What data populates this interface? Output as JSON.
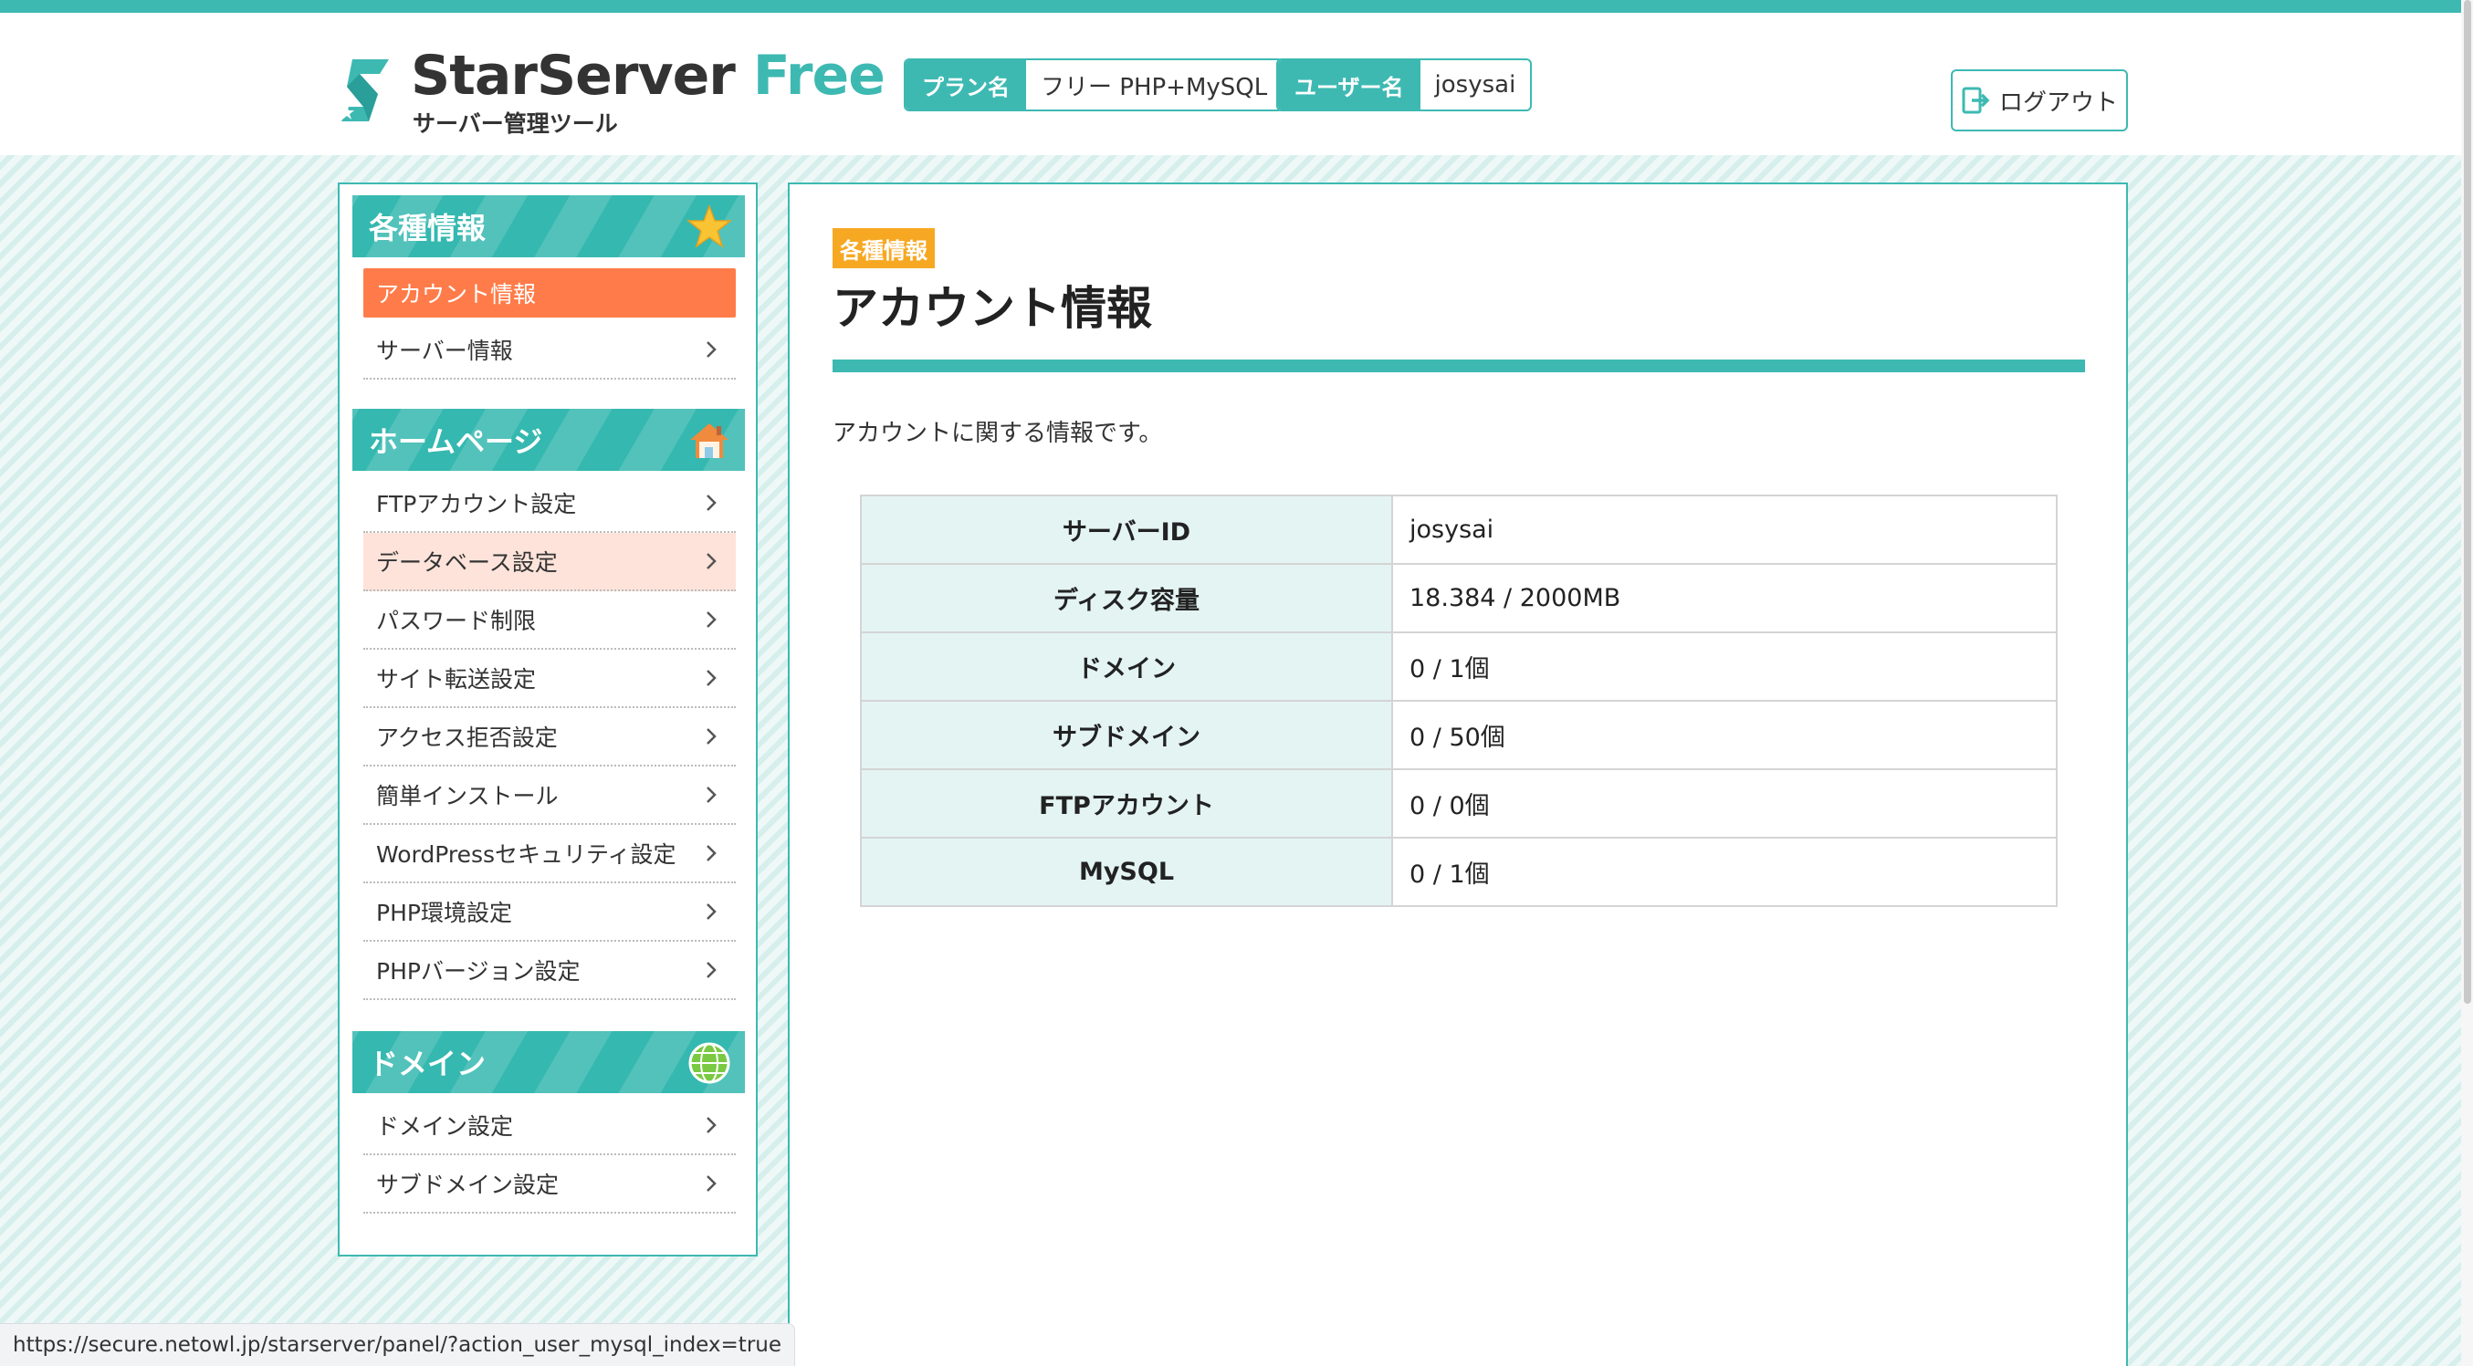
{
  "header": {
    "logo": {
      "name": "StarServer",
      "name_accent": "Free",
      "subtitle": "サーバー管理ツール"
    },
    "plan": {
      "label": "プラン名",
      "value": "フリー PHP+MySQL"
    },
    "user": {
      "label": "ユーザー名",
      "value": "josysai"
    },
    "logout_label": "ログアウト"
  },
  "sidebar": {
    "sections": [
      {
        "title": "各種情報",
        "icon": "star-icon",
        "items": [
          {
            "label": "アカウント情報",
            "state": "active"
          },
          {
            "label": "サーバー情報"
          }
        ]
      },
      {
        "title": "ホームページ",
        "icon": "house-icon",
        "items": [
          {
            "label": "FTPアカウント設定"
          },
          {
            "label": "データベース設定",
            "state": "hover"
          },
          {
            "label": "パスワード制限"
          },
          {
            "label": "サイト転送設定"
          },
          {
            "label": "アクセス拒否設定"
          },
          {
            "label": "簡単インストール"
          },
          {
            "label": "WordPressセキュリティ設定"
          },
          {
            "label": "PHP環境設定"
          },
          {
            "label": "PHPバージョン設定"
          }
        ]
      },
      {
        "title": "ドメイン",
        "icon": "globe-icon",
        "items": [
          {
            "label": "ドメイン設定"
          },
          {
            "label": "サブドメイン設定"
          }
        ]
      }
    ]
  },
  "main": {
    "category": "各種情報",
    "title": "アカウント情報",
    "description": "アカウントに関する情報です。",
    "table": [
      {
        "key": "サーバーID",
        "value": "josysai"
      },
      {
        "key": "ディスク容量",
        "value": "18.384 / 2000MB"
      },
      {
        "key": "ドメイン",
        "value": "0 / 1個"
      },
      {
        "key": "サブドメイン",
        "value": "0 / 50個"
      },
      {
        "key": "FTPアカウント",
        "value": "0 / 0個"
      },
      {
        "key": "MySQL",
        "value": "0 / 1個"
      }
    ]
  },
  "status_bar_url": "https://secure.netowl.jp/starserver/panel/?action_user_mysql_index=true",
  "colors": {
    "accent": "#3db9b2",
    "active": "#ff7c4a",
    "hover": "#fde3da",
    "badge": "#f7a823",
    "table_key_bg": "#e3f4f3"
  }
}
